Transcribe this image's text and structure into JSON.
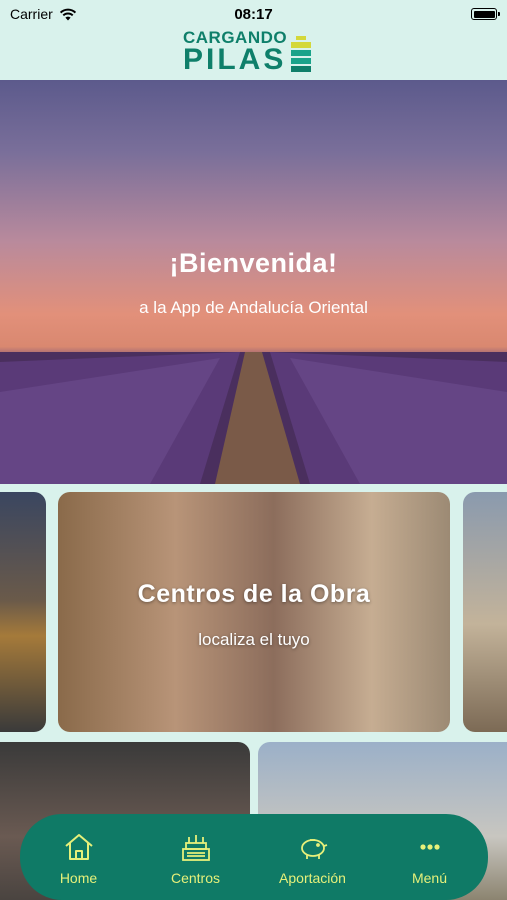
{
  "status_bar": {
    "carrier": "Carrier",
    "time": "08:17"
  },
  "logo": {
    "line1": "CARGANDO",
    "line2": "PILAS",
    "colors": {
      "text": "#0f7f6a",
      "battery_top": "#d4d83a",
      "battery_mid": "#1aa38a",
      "battery_bottom": "#1aa38a"
    }
  },
  "hero": {
    "title": "¡Bienvenida!",
    "subtitle": "a la App de Andalucía Oriental"
  },
  "carousel": {
    "title": "Centros de la Obra",
    "subtitle": "localiza el tuyo"
  },
  "tabbar": {
    "items": [
      {
        "label": "Home",
        "icon": "home-icon"
      },
      {
        "label": "Centros",
        "icon": "buildings-icon"
      },
      {
        "label": "Aportación",
        "icon": "piggy-bank-icon"
      },
      {
        "label": "Menú",
        "icon": "more-dots-icon"
      }
    ],
    "colors": {
      "background": "#0f7a66",
      "foreground": "#e6f07a"
    }
  },
  "colors": {
    "page_background": "#d9f2ec"
  }
}
